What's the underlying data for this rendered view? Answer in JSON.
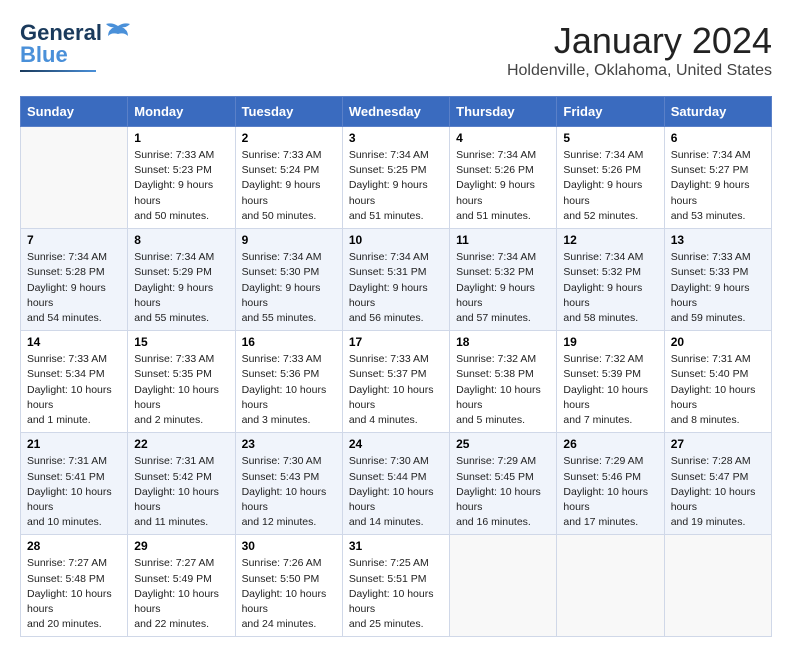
{
  "header": {
    "logo_general": "General",
    "logo_blue": "Blue",
    "main_title": "January 2024",
    "subtitle": "Holdenville, Oklahoma, United States"
  },
  "days_of_week": [
    "Sunday",
    "Monday",
    "Tuesday",
    "Wednesday",
    "Thursday",
    "Friday",
    "Saturday"
  ],
  "weeks": [
    [
      {
        "day": "",
        "sunrise": "",
        "sunset": "",
        "daylight": ""
      },
      {
        "day": "1",
        "sunrise": "Sunrise: 7:33 AM",
        "sunset": "Sunset: 5:23 PM",
        "daylight": "Daylight: 9 hours and 50 minutes."
      },
      {
        "day": "2",
        "sunrise": "Sunrise: 7:33 AM",
        "sunset": "Sunset: 5:24 PM",
        "daylight": "Daylight: 9 hours and 50 minutes."
      },
      {
        "day": "3",
        "sunrise": "Sunrise: 7:34 AM",
        "sunset": "Sunset: 5:25 PM",
        "daylight": "Daylight: 9 hours and 51 minutes."
      },
      {
        "day": "4",
        "sunrise": "Sunrise: 7:34 AM",
        "sunset": "Sunset: 5:26 PM",
        "daylight": "Daylight: 9 hours and 51 minutes."
      },
      {
        "day": "5",
        "sunrise": "Sunrise: 7:34 AM",
        "sunset": "Sunset: 5:26 PM",
        "daylight": "Daylight: 9 hours and 52 minutes."
      },
      {
        "day": "6",
        "sunrise": "Sunrise: 7:34 AM",
        "sunset": "Sunset: 5:27 PM",
        "daylight": "Daylight: 9 hours and 53 minutes."
      }
    ],
    [
      {
        "day": "7",
        "sunrise": "Sunrise: 7:34 AM",
        "sunset": "Sunset: 5:28 PM",
        "daylight": "Daylight: 9 hours and 54 minutes."
      },
      {
        "day": "8",
        "sunrise": "Sunrise: 7:34 AM",
        "sunset": "Sunset: 5:29 PM",
        "daylight": "Daylight: 9 hours and 55 minutes."
      },
      {
        "day": "9",
        "sunrise": "Sunrise: 7:34 AM",
        "sunset": "Sunset: 5:30 PM",
        "daylight": "Daylight: 9 hours and 55 minutes."
      },
      {
        "day": "10",
        "sunrise": "Sunrise: 7:34 AM",
        "sunset": "Sunset: 5:31 PM",
        "daylight": "Daylight: 9 hours and 56 minutes."
      },
      {
        "day": "11",
        "sunrise": "Sunrise: 7:34 AM",
        "sunset": "Sunset: 5:32 PM",
        "daylight": "Daylight: 9 hours and 57 minutes."
      },
      {
        "day": "12",
        "sunrise": "Sunrise: 7:34 AM",
        "sunset": "Sunset: 5:32 PM",
        "daylight": "Daylight: 9 hours and 58 minutes."
      },
      {
        "day": "13",
        "sunrise": "Sunrise: 7:33 AM",
        "sunset": "Sunset: 5:33 PM",
        "daylight": "Daylight: 9 hours and 59 minutes."
      }
    ],
    [
      {
        "day": "14",
        "sunrise": "Sunrise: 7:33 AM",
        "sunset": "Sunset: 5:34 PM",
        "daylight": "Daylight: 10 hours and 1 minute."
      },
      {
        "day": "15",
        "sunrise": "Sunrise: 7:33 AM",
        "sunset": "Sunset: 5:35 PM",
        "daylight": "Daylight: 10 hours and 2 minutes."
      },
      {
        "day": "16",
        "sunrise": "Sunrise: 7:33 AM",
        "sunset": "Sunset: 5:36 PM",
        "daylight": "Daylight: 10 hours and 3 minutes."
      },
      {
        "day": "17",
        "sunrise": "Sunrise: 7:33 AM",
        "sunset": "Sunset: 5:37 PM",
        "daylight": "Daylight: 10 hours and 4 minutes."
      },
      {
        "day": "18",
        "sunrise": "Sunrise: 7:32 AM",
        "sunset": "Sunset: 5:38 PM",
        "daylight": "Daylight: 10 hours and 5 minutes."
      },
      {
        "day": "19",
        "sunrise": "Sunrise: 7:32 AM",
        "sunset": "Sunset: 5:39 PM",
        "daylight": "Daylight: 10 hours and 7 minutes."
      },
      {
        "day": "20",
        "sunrise": "Sunrise: 7:31 AM",
        "sunset": "Sunset: 5:40 PM",
        "daylight": "Daylight: 10 hours and 8 minutes."
      }
    ],
    [
      {
        "day": "21",
        "sunrise": "Sunrise: 7:31 AM",
        "sunset": "Sunset: 5:41 PM",
        "daylight": "Daylight: 10 hours and 10 minutes."
      },
      {
        "day": "22",
        "sunrise": "Sunrise: 7:31 AM",
        "sunset": "Sunset: 5:42 PM",
        "daylight": "Daylight: 10 hours and 11 minutes."
      },
      {
        "day": "23",
        "sunrise": "Sunrise: 7:30 AM",
        "sunset": "Sunset: 5:43 PM",
        "daylight": "Daylight: 10 hours and 12 minutes."
      },
      {
        "day": "24",
        "sunrise": "Sunrise: 7:30 AM",
        "sunset": "Sunset: 5:44 PM",
        "daylight": "Daylight: 10 hours and 14 minutes."
      },
      {
        "day": "25",
        "sunrise": "Sunrise: 7:29 AM",
        "sunset": "Sunset: 5:45 PM",
        "daylight": "Daylight: 10 hours and 16 minutes."
      },
      {
        "day": "26",
        "sunrise": "Sunrise: 7:29 AM",
        "sunset": "Sunset: 5:46 PM",
        "daylight": "Daylight: 10 hours and 17 minutes."
      },
      {
        "day": "27",
        "sunrise": "Sunrise: 7:28 AM",
        "sunset": "Sunset: 5:47 PM",
        "daylight": "Daylight: 10 hours and 19 minutes."
      }
    ],
    [
      {
        "day": "28",
        "sunrise": "Sunrise: 7:27 AM",
        "sunset": "Sunset: 5:48 PM",
        "daylight": "Daylight: 10 hours and 20 minutes."
      },
      {
        "day": "29",
        "sunrise": "Sunrise: 7:27 AM",
        "sunset": "Sunset: 5:49 PM",
        "daylight": "Daylight: 10 hours and 22 minutes."
      },
      {
        "day": "30",
        "sunrise": "Sunrise: 7:26 AM",
        "sunset": "Sunset: 5:50 PM",
        "daylight": "Daylight: 10 hours and 24 minutes."
      },
      {
        "day": "31",
        "sunrise": "Sunrise: 7:25 AM",
        "sunset": "Sunset: 5:51 PM",
        "daylight": "Daylight: 10 hours and 25 minutes."
      },
      {
        "day": "",
        "sunrise": "",
        "sunset": "",
        "daylight": ""
      },
      {
        "day": "",
        "sunrise": "",
        "sunset": "",
        "daylight": ""
      },
      {
        "day": "",
        "sunrise": "",
        "sunset": "",
        "daylight": ""
      }
    ]
  ]
}
